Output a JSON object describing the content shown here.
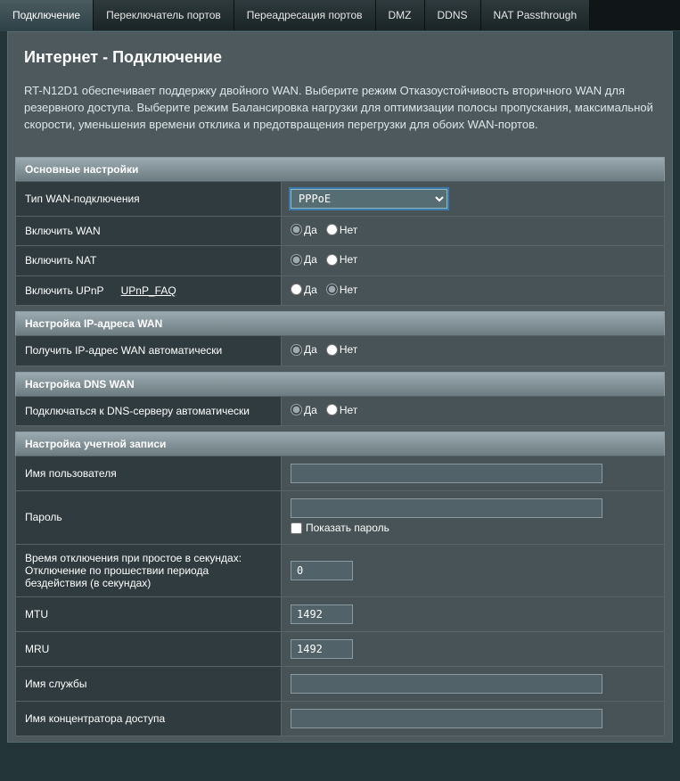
{
  "tabs": {
    "t0": "Подключение",
    "t1": "Переключатель портов",
    "t2": "Переадресация портов",
    "t3": "DMZ",
    "t4": "DDNS",
    "t5": "NAT Passthrough"
  },
  "page": {
    "title": "Интернет - Подключение",
    "intro": "RT-N12D1 обеспечивает поддержку двойного WAN. Выберите режим Отказоустойчивость вторичного WAN для резервного доступа. Выберите режим Балансировка нагрузки для оптимизации полосы пропускания, максимальной скорости, уменьшения времени отклика и предотвращения перегрузки для обоих WAN-портов."
  },
  "labels": {
    "yes": "Да",
    "no": "Нет"
  },
  "sections": {
    "basic": {
      "header": "Основные настройки",
      "wan_type_label": "Тип WAN-подключения",
      "wan_type_value": "PPPoE",
      "enable_wan_label": "Включить WAN",
      "enable_wan": "yes",
      "enable_nat_label": "Включить NAT",
      "enable_nat": "yes",
      "enable_upnp_label": "Включить UPnP",
      "upnp_faq": "UPnP_FAQ",
      "enable_upnp": "no"
    },
    "wanip": {
      "header": "Настройка IP-адреса WAN",
      "auto_ip_label": "Получить IP-адрес WAN автоматически",
      "auto_ip": "yes"
    },
    "dns": {
      "header": "Настройка DNS WAN",
      "auto_dns_label": "Подключаться к DNS-серверу автоматически",
      "auto_dns": "yes"
    },
    "account": {
      "header": "Настройка учетной записи",
      "username_label": "Имя пользователя",
      "username_value": "",
      "password_label": "Пароль",
      "password_value": "",
      "show_password_label": "Показать пароль",
      "idle_label": "Время отключения при простое в секундах: Отключение по прошествии периода бездействия (в секундах)",
      "idle_value": "0",
      "mtu_label": "MTU",
      "mtu_value": "1492",
      "mru_label": "MRU",
      "mru_value": "1492",
      "service_label": "Имя службы",
      "service_value": "",
      "ac_label": "Имя концентратора доступа",
      "ac_value": ""
    }
  }
}
